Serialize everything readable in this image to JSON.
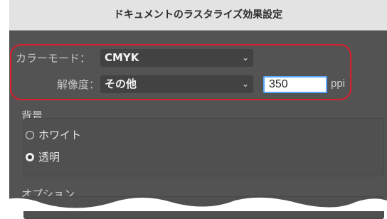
{
  "dialog": {
    "title": "ドキュメントのラスタライズ効果設定"
  },
  "color_mode": {
    "label": "カラーモード：",
    "value": "CMYK"
  },
  "resolution": {
    "label": "解像度：",
    "value": "その他",
    "ppi_value": "350",
    "unit": "ppi"
  },
  "background": {
    "title": "背景",
    "options": [
      {
        "label": "ホワイト",
        "selected": false
      },
      {
        "label": "透明",
        "selected": true
      }
    ]
  },
  "options_section": {
    "title": "オプション"
  },
  "colors": {
    "highlight": "#d7202c",
    "focus": "#58a6ff",
    "panel": "#535353"
  }
}
